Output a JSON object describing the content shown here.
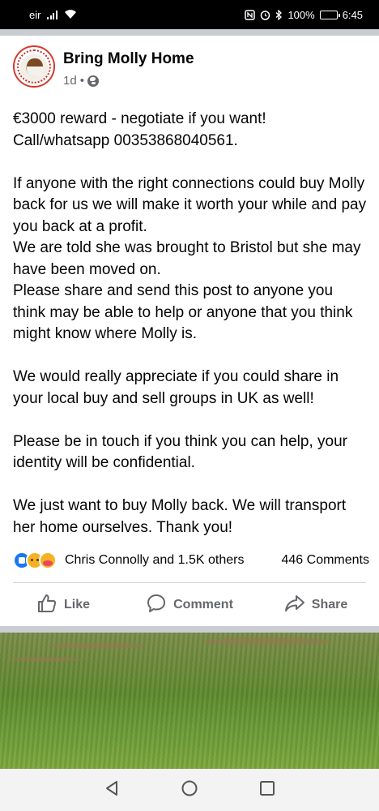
{
  "status_bar": {
    "carrier": "eir",
    "battery": "100%",
    "time": "6:45",
    "battery_level": 1.0
  },
  "post": {
    "page_name": "Bring Molly Home",
    "time_ago": "1d",
    "separator": "•",
    "audience_icon": "globe-icon",
    "paragraphs": [
      "€3000 reward - negotiate if you want!",
      "Call/whatsapp 00353868040561.",
      "",
      "If anyone with the right connections could buy Molly back for us we will make it worth your while and pay you back at a profit.",
      "We are told she was brought to Bristol but she may have been moved on.",
      "Please share and send this post to anyone you think may be able to help or anyone that you think might know where Molly is.",
      "",
      "We would really appreciate if you could share in your local buy and sell groups in UK as well!",
      "",
      "Please be in touch if you think you can help, your identity will be confidential.",
      "",
      "We just want to buy Molly back. We will transport her home ourselves. Thank you!"
    ],
    "reactions": {
      "icons": [
        "like-icon",
        "sad-icon",
        "care-icon"
      ],
      "summary": "Chris Connolly and 1.5K others",
      "comments": "446 Comments"
    },
    "actions": {
      "like": "Like",
      "comment": "Comment",
      "share": "Share"
    }
  },
  "nav": {
    "icons": [
      "back-icon",
      "home-icon",
      "recents-icon"
    ]
  },
  "colors": {
    "accent": "#1877f2",
    "secondary_text": "#65676b",
    "separator": "#c9ccd1"
  }
}
